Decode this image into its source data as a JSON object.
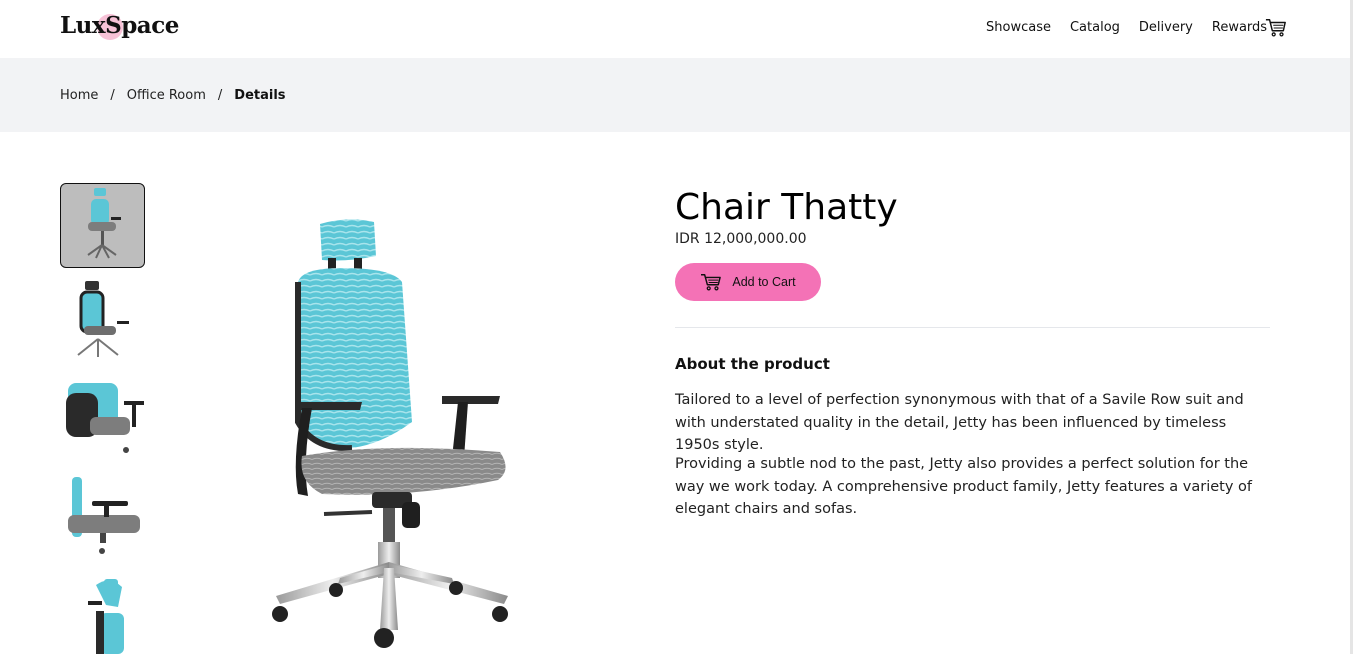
{
  "brand": {
    "name": "LuxSpace"
  },
  "nav": {
    "items": [
      {
        "label": "Showcase"
      },
      {
        "label": "Catalog"
      },
      {
        "label": "Delivery"
      },
      {
        "label": "Rewards"
      }
    ],
    "cart_icon": "cart-icon"
  },
  "breadcrumb": {
    "home": "Home",
    "category": "Office Room",
    "current": "Details",
    "separator": "/"
  },
  "product": {
    "title": "Chair Thatty",
    "price": "IDR 12,000,000.00",
    "add_to_cart": "Add to Cart",
    "about_heading": "About the product",
    "description": [
      "Tailored to a level of perfection synonymous with that of a Savile Row suit and with understated quality in the detail, Jetty has been influenced by timeless 1950s style.",
      "Providing a subtle nod to the past, Jetty also provides a perfect solution for the way we work today. A comprehensive product family, Jetty features a variety of elegant chairs and sofas."
    ]
  },
  "colors": {
    "accent": "#f472b6",
    "band": "#f2f3f5",
    "mesh": "#5bc6d6",
    "seat": "#8e8e8e"
  }
}
